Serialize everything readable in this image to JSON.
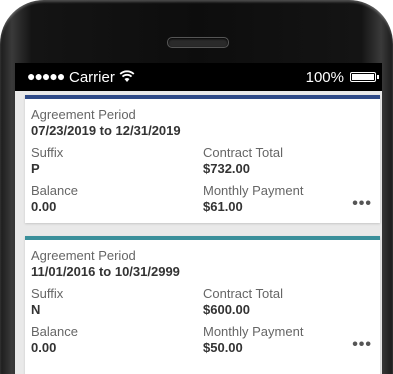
{
  "status_bar": {
    "signal_dots": "●●●●●",
    "carrier": "Carrier",
    "battery_percent": "100%",
    "battery_level": 1.0
  },
  "agreements": [
    {
      "accent_color": "#2e4a87",
      "agreement_period_label": "Agreement Period",
      "agreement_period": "07/23/2019 to 12/31/2019",
      "suffix_label": "Suffix",
      "suffix": "P",
      "contract_total_label": "Contract Total",
      "contract_total": "$732.00",
      "balance_label": "Balance",
      "balance": "0.00",
      "monthly_payment_label": "Monthly Payment",
      "monthly_payment": "$61.00",
      "more_icon": "more-horizontal-icon"
    },
    {
      "accent_color": "#3a8f9a",
      "agreement_period_label": "Agreement Period",
      "agreement_period": "11/01/2016 to 10/31/2999",
      "suffix_label": "Suffix",
      "suffix": "N",
      "contract_total_label": "Contract Total",
      "contract_total": "$600.00",
      "balance_label": "Balance",
      "balance": "0.00",
      "monthly_payment_label": "Monthly Payment",
      "monthly_payment": "$50.00",
      "more_icon": "more-horizontal-icon"
    }
  ]
}
